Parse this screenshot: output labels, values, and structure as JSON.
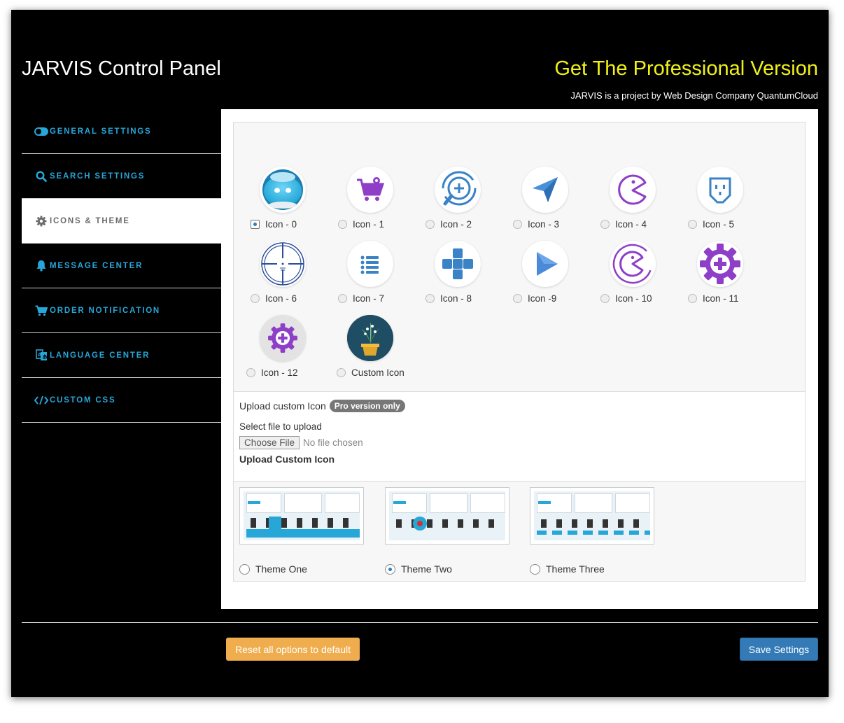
{
  "header": {
    "title": "JARVIS Control Panel",
    "pro_link": "Get The Professional Version",
    "byline": "JARVIS is a project by Web Design Company QuantumCloud"
  },
  "sidebar": {
    "items": [
      {
        "label": "GENERAL SETTINGS",
        "icon": "toggle-icon"
      },
      {
        "label": "SEARCH SETTINGS",
        "icon": "search-icon"
      },
      {
        "label": "ICONS & THEME",
        "icon": "gear-icon",
        "active": true
      },
      {
        "label": "MESSAGE CENTER",
        "icon": "bell-icon"
      },
      {
        "label": "ORDER NOTIFICATION",
        "icon": "cart-icon"
      },
      {
        "label": "LANGUAGE CENTER",
        "icon": "translate-icon"
      },
      {
        "label": "CUSTOM CSS",
        "icon": "code-icon"
      }
    ]
  },
  "icons": {
    "selected": "Icon - 0",
    "options": [
      {
        "label": "Icon - 0",
        "icon": "robot-face-icon"
      },
      {
        "label": "Icon - 1",
        "icon": "shopping-cart-icon"
      },
      {
        "label": "Icon - 2",
        "icon": "search-plus-icon"
      },
      {
        "label": "Icon - 3",
        "icon": "paper-plane-icon"
      },
      {
        "label": "Icon - 4",
        "icon": "pacman-icon"
      },
      {
        "label": "Icon - 5",
        "icon": "plug-face-icon"
      },
      {
        "label": "Icon - 6",
        "icon": "crosshair-icon"
      },
      {
        "label": "Icon - 7",
        "icon": "list-icon"
      },
      {
        "label": "Icon - 8",
        "icon": "plus-blocks-icon"
      },
      {
        "label": "Icon -9",
        "icon": "play-arrow-icon"
      },
      {
        "label": "Icon - 10",
        "icon": "pacman-ring-icon"
      },
      {
        "label": "Icon - 11",
        "icon": "gear-plus-icon"
      },
      {
        "label": "Icon - 12",
        "icon": "gear-plus-grey-icon"
      },
      {
        "label": "Custom Icon",
        "icon": "plant-pot-icon"
      }
    ]
  },
  "upload": {
    "title": "Upload custom Icon",
    "badge": "Pro version only",
    "select_label": "Select file to upload",
    "choose_button": "Choose File",
    "no_file": "No file chosen",
    "upload_button": "Upload Custom Icon"
  },
  "themes": {
    "selected": "Theme Two",
    "options": [
      {
        "label": "Theme One"
      },
      {
        "label": "Theme Two"
      },
      {
        "label": "Theme Three"
      }
    ]
  },
  "footer": {
    "reset_label": "Reset all options to default",
    "save_label": "Save Settings"
  },
  "colors": {
    "frame_bg": "#000000",
    "pro_link": "#f1f118",
    "nav_text": "#27a6d8",
    "reset_button": "#f0ad4e",
    "save_button": "#337ab7",
    "icon_purple": "#8e3ec7",
    "icon_blue": "#3a83c6"
  }
}
